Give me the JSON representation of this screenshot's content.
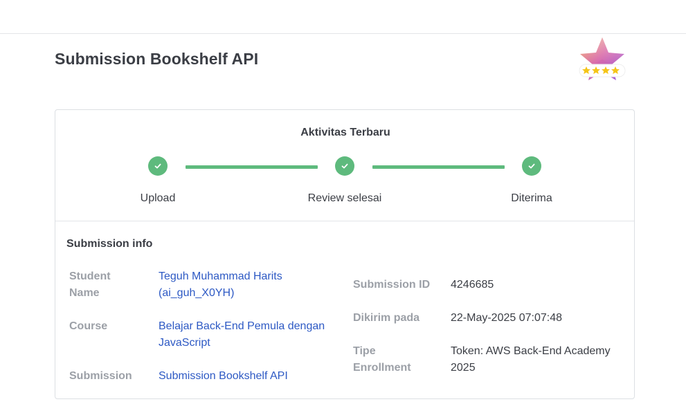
{
  "header": {
    "title": "Submission Bookshelf API"
  },
  "badge": {
    "icon": "star-rating-badge-icon",
    "stars": 4,
    "star_color": "#f5c518"
  },
  "activity": {
    "title": "Aktivitas Terbaru",
    "steps": [
      {
        "label": "Upload",
        "status": "done"
      },
      {
        "label": "Review selesai",
        "status": "done"
      },
      {
        "label": "Diterima",
        "status": "done"
      }
    ],
    "accent_color": "#5eba7d"
  },
  "info": {
    "title": "Submission info",
    "student_name_label": "Student Name",
    "student_name_value": "Teguh Muhammad Harits (ai_guh_X0YH)",
    "course_label": "Course",
    "course_value": "Belajar Back-End Pemula dengan JavaScript",
    "submission_label": "Submission",
    "submission_value": "Submission Bookshelf API",
    "submission_id_label": "Submission ID",
    "submission_id_value": "4246685",
    "sent_label": "Dikirim pada",
    "sent_value": "22-May-2025 07:07:48",
    "enrollment_label": "Tipe Enrollment",
    "enrollment_value": "Token: AWS Back-End Academy 2025",
    "link_color": "#2d59c4"
  }
}
